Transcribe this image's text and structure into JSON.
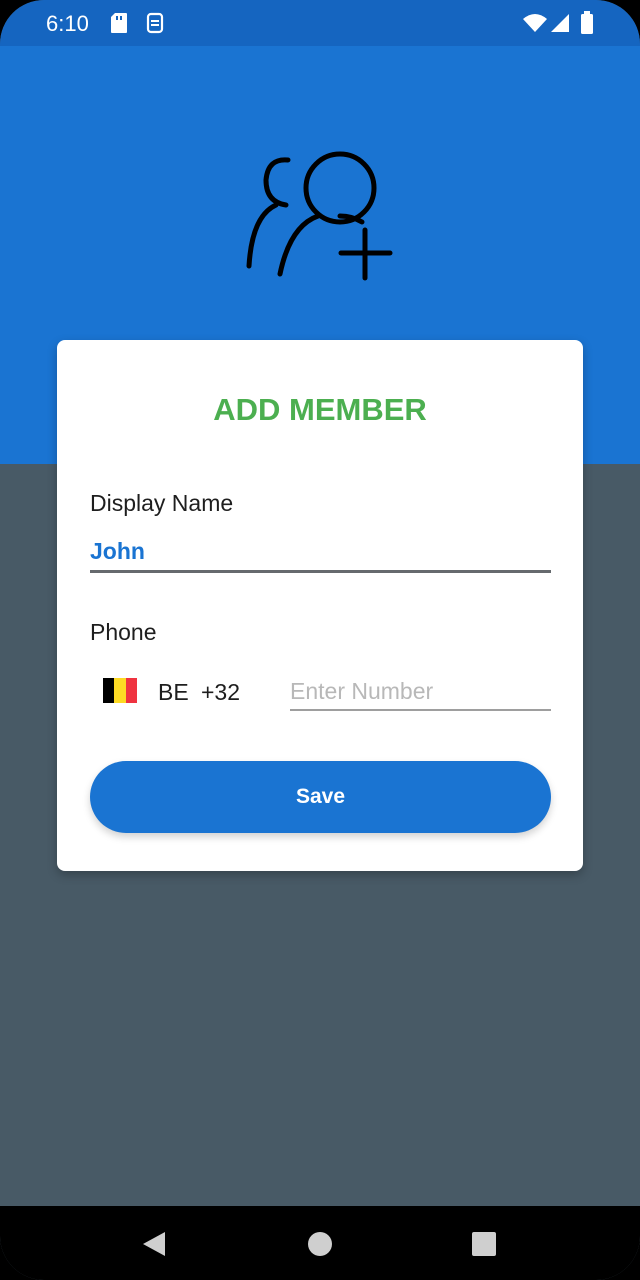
{
  "status_bar": {
    "time": "6:10",
    "left_icons": [
      "sd-card-icon",
      "sync-icon"
    ],
    "right_icons": [
      "wifi-icon",
      "signal-icon",
      "battery-icon"
    ]
  },
  "header": {
    "icon": "add-group-icon"
  },
  "form": {
    "title": "ADD MEMBER",
    "display_name_label": "Display Name",
    "display_name_value": "John",
    "phone_label": "Phone",
    "country_code": "BE",
    "dial_code": "+32",
    "number_placeholder": "Enter Number",
    "number_value": "",
    "save_label": "Save"
  },
  "nav_bar": {
    "buttons": [
      "back-icon",
      "home-icon",
      "recents-icon"
    ]
  },
  "colors": {
    "status_bar": "#1565c0",
    "header_band": "#1a74d2",
    "background": "#485a66",
    "title": "#4caf50",
    "accent": "#1a74d2",
    "flag": [
      "#000000",
      "#fdda24",
      "#ef3340"
    ]
  }
}
